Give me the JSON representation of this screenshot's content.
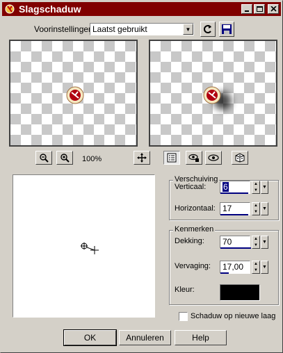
{
  "window": {
    "title": "Slagschaduw",
    "controls": {
      "minimize": "_",
      "maximize": "□",
      "close": "×"
    }
  },
  "preset": {
    "label": "Voorinstellingen:",
    "value": "Laatst gebruikt"
  },
  "zoom": {
    "level": "100%"
  },
  "offset_group": {
    "title": "Verschuiving",
    "vertical": {
      "label": "Verticaal:",
      "value": "6"
    },
    "horizontal": {
      "label": "Horizontaal:",
      "value": "17"
    }
  },
  "props_group": {
    "title": "Kenmerken",
    "opacity": {
      "label": "Dekking:",
      "value": "70"
    },
    "blur": {
      "label": "Vervaging:",
      "value": "17,00"
    },
    "color": {
      "label": "Kleur:",
      "value": "#000000"
    }
  },
  "checkbox": {
    "label": "Schaduw op nieuwe laag",
    "checked": false
  },
  "buttons": {
    "ok": "OK",
    "cancel": "Annuleren",
    "help": "Help"
  },
  "colors": {
    "titlebar": "#800000",
    "face": "#d4d0c8"
  }
}
